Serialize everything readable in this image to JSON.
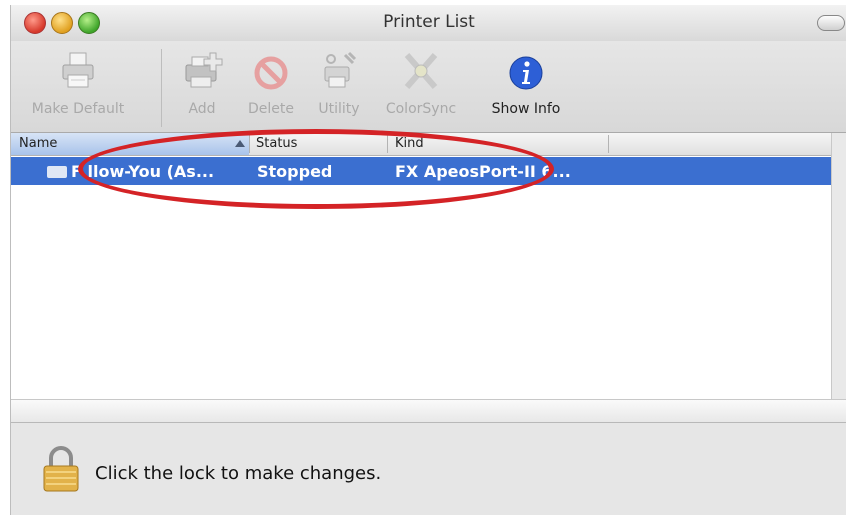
{
  "window": {
    "title": "Printer List"
  },
  "toolbar": {
    "items": [
      {
        "label": "Make Default",
        "icon": "printer-icon",
        "enabled": false
      },
      {
        "label": "Add",
        "icon": "add-printer-icon",
        "enabled": false
      },
      {
        "label": "Delete",
        "icon": "delete-icon",
        "enabled": false
      },
      {
        "label": "Utility",
        "icon": "utility-icon",
        "enabled": false
      },
      {
        "label": "ColorSync",
        "icon": "colorsync-icon",
        "enabled": false
      },
      {
        "label": "Show Info",
        "icon": "info-icon",
        "enabled": true
      }
    ]
  },
  "table": {
    "columns": [
      "Name",
      "Status",
      "Kind"
    ],
    "sorted_column": "Name",
    "rows": [
      {
        "name": "F llow-You (As...",
        "status": "Stopped",
        "kind": "FX ApeosPort-II 6...",
        "selected": true
      }
    ]
  },
  "footer": {
    "lock_text": "Click the lock to make changes."
  },
  "colors": {
    "selection": "#3b6fd0",
    "annotation": "#d42326"
  }
}
